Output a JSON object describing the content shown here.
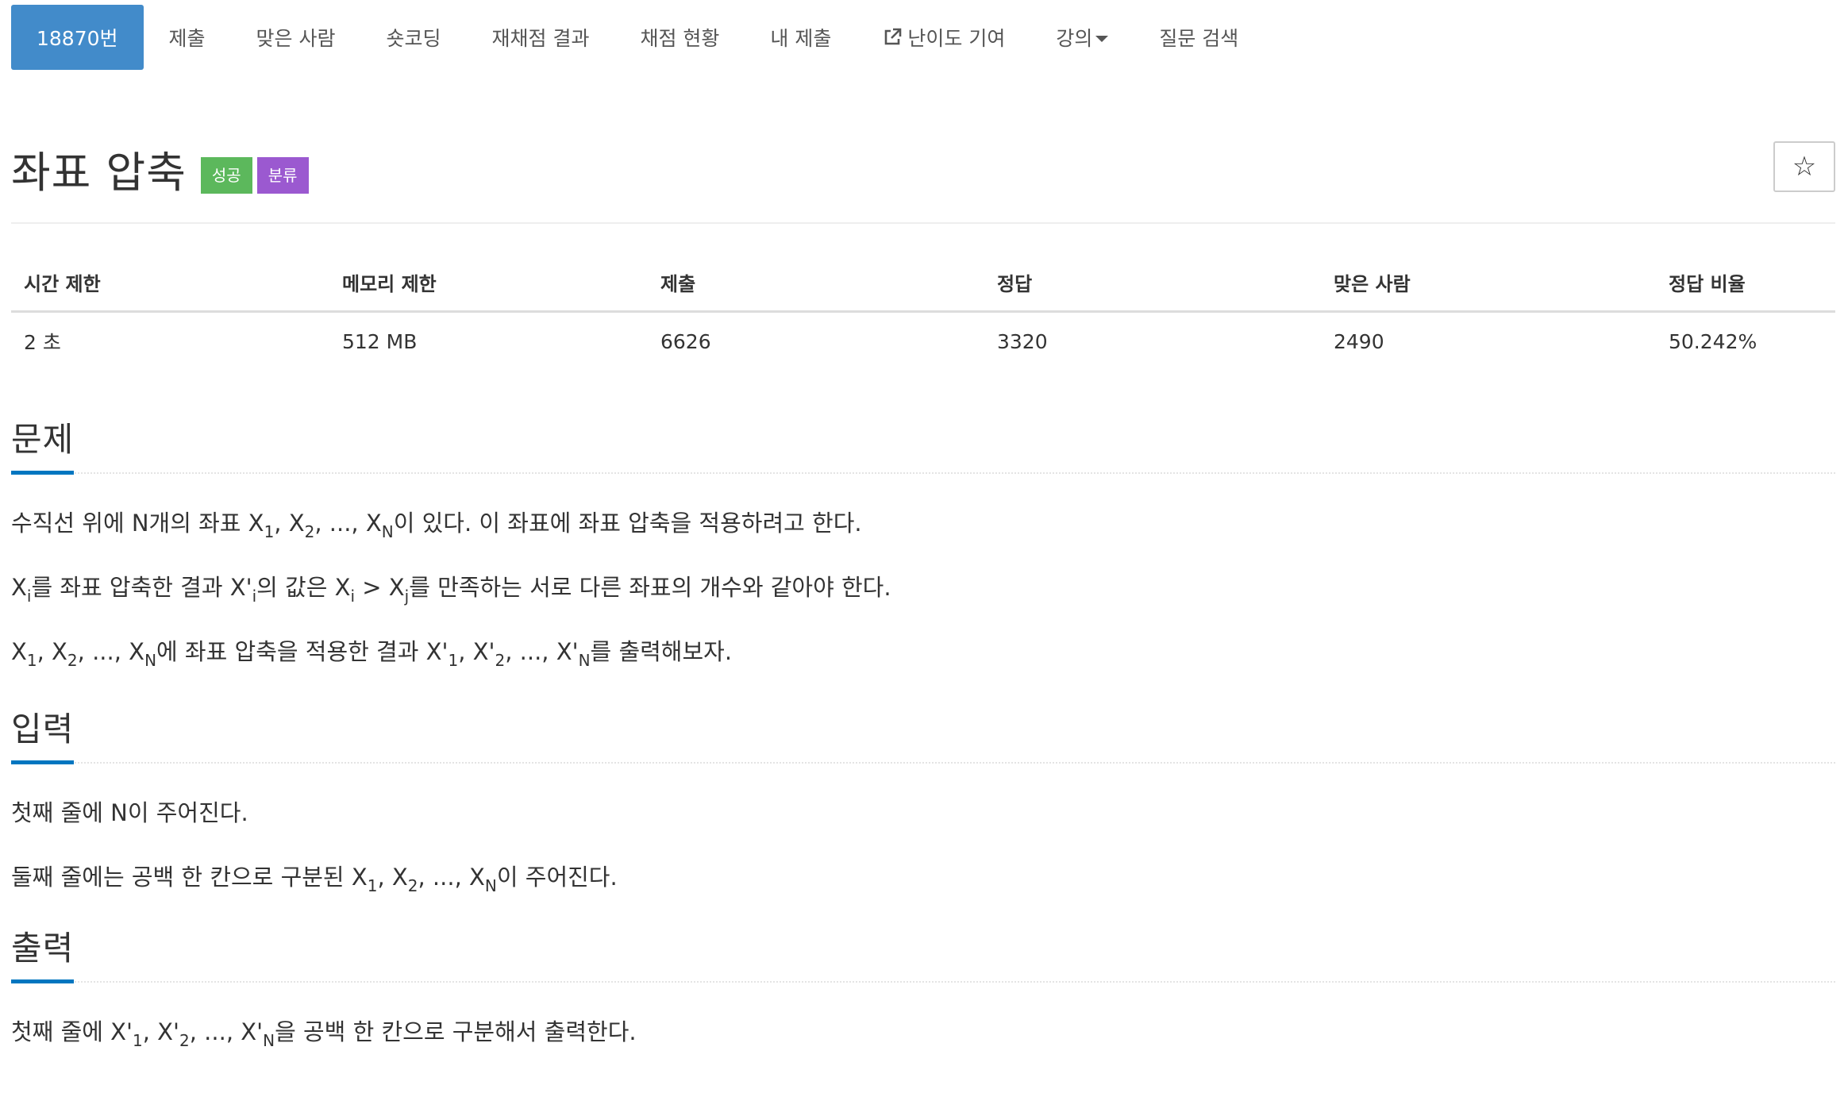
{
  "nav": {
    "items": [
      {
        "label": "18870번",
        "active": true
      },
      {
        "label": "제출"
      },
      {
        "label": "맞은 사람"
      },
      {
        "label": "숏코딩"
      },
      {
        "label": "재채점 결과"
      },
      {
        "label": "채점 현황"
      },
      {
        "label": "내 제출"
      },
      {
        "label": "난이도 기여",
        "icon": "external-link-icon"
      },
      {
        "label": "강의",
        "icon": "caret-down-icon"
      },
      {
        "label": "질문 검색"
      }
    ]
  },
  "problem": {
    "title": "좌표 압축",
    "badges": {
      "success": "성공",
      "category": "분류"
    },
    "star_icon": "☆"
  },
  "info": {
    "headers": [
      "시간 제한",
      "메모리 제한",
      "제출",
      "정답",
      "맞은 사람",
      "정답 비율"
    ],
    "values": [
      "2 초",
      "512 MB",
      "6626",
      "3320",
      "2490",
      "50.242%"
    ]
  },
  "sections": {
    "problem": {
      "title": "문제",
      "line1": {
        "a": "수직선 위에 N개의 좌표 X",
        "s1": "1",
        "b": ", X",
        "s2": "2",
        "c": ", ..., X",
        "s3": "N",
        "d": "이 있다. 이 좌표에 좌표 압축을 적용하려고 한다."
      },
      "line2": {
        "a": "X",
        "s1": "i",
        "b": "를 좌표 압축한 결과 X'",
        "s2": "i",
        "c": "의 값은 X",
        "s3": "i",
        "d": " > X",
        "s4": "j",
        "e": "를 만족하는 서로 다른 좌표의 개수와 같아야 한다."
      },
      "line3": {
        "a": "X",
        "s1": "1",
        "b": ", X",
        "s2": "2",
        "c": ", ..., X",
        "s3": "N",
        "d": "에 좌표 압축을 적용한 결과 X'",
        "s4": "1",
        "e": ", X'",
        "s5": "2",
        "f": ", ..., X'",
        "s6": "N",
        "g": "를 출력해보자."
      }
    },
    "input": {
      "title": "입력",
      "line1": "첫째 줄에 N이 주어진다.",
      "line2": {
        "a": "둘째 줄에는 공백 한 칸으로 구분된 X",
        "s1": "1",
        "b": ", X",
        "s2": "2",
        "c": ", ..., X",
        "s3": "N",
        "d": "이 주어진다."
      }
    },
    "output": {
      "title": "출력",
      "line1": {
        "a": "첫째 줄에 X'",
        "s1": "1",
        "b": ", X'",
        "s2": "2",
        "c": ", ..., X'",
        "s3": "N",
        "d": "을 공백 한 칸으로 구분해서 출력한다."
      }
    }
  },
  "colors": {
    "nav_active": "#428bca",
    "badge_success": "#5cb85c",
    "badge_category": "#9b59d0",
    "section_underline": "#0076c0"
  }
}
